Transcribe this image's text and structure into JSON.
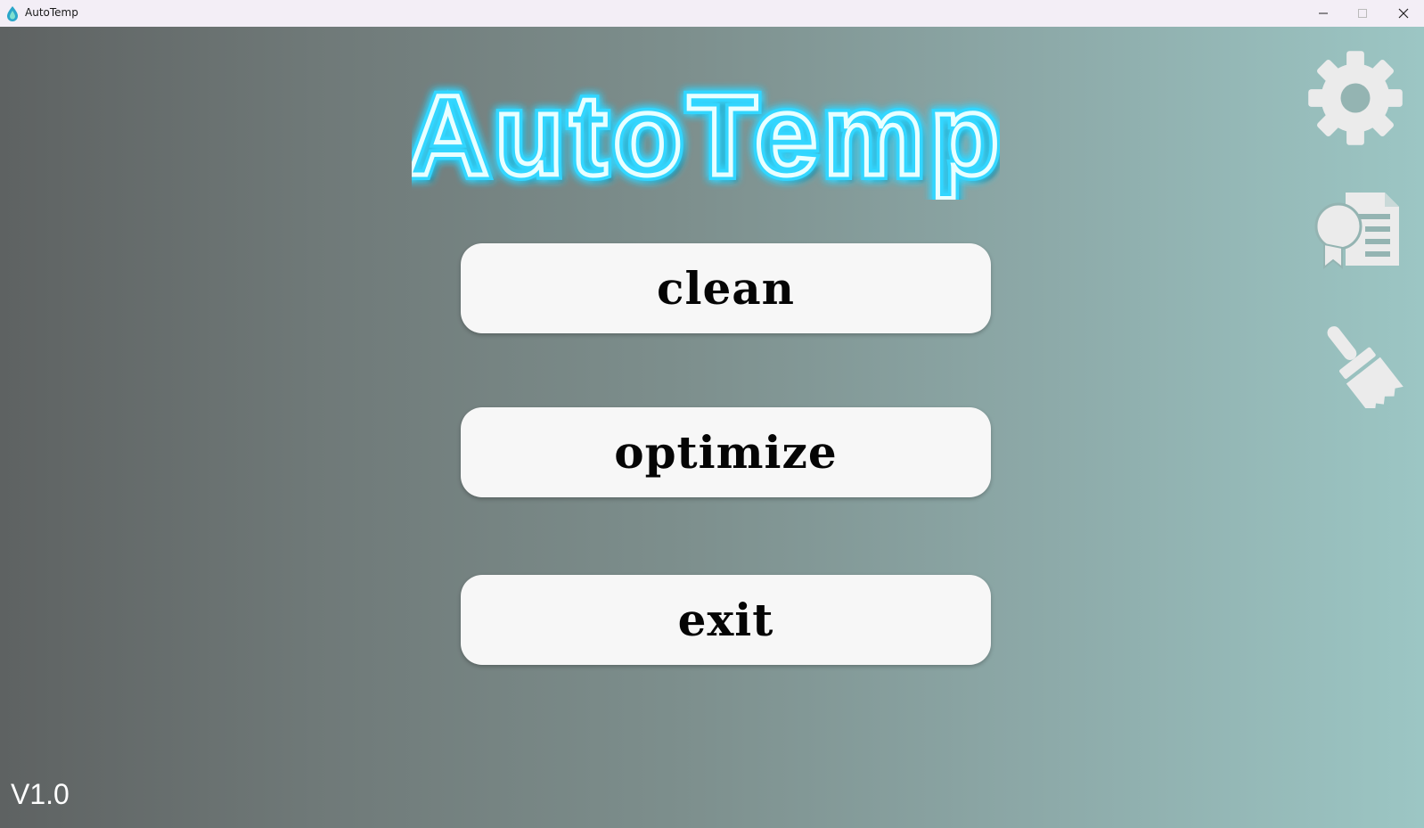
{
  "window": {
    "title": "AutoTemp",
    "controls": [
      "minimize",
      "maximize",
      "close"
    ]
  },
  "logo": {
    "text": "AutoTemp",
    "glow_color": "#33d6ff"
  },
  "buttons": {
    "clean_label": "clean",
    "optimize_label": "optimize",
    "exit_label": "exit"
  },
  "side_icons": [
    "gear-icon",
    "certificate-icon",
    "brush-icon"
  ],
  "footer": {
    "version": "V1.0"
  },
  "colors": {
    "background_left": "#5e6262",
    "background_right": "#9cc6c4",
    "button_bg": "#f7f7f7",
    "icon_color": "#ebebeb"
  }
}
